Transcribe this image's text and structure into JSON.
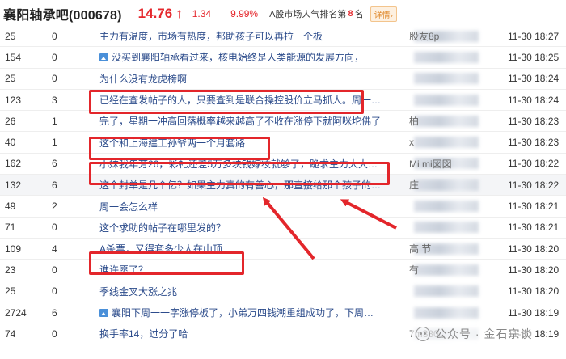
{
  "header": {
    "title": "襄阳轴承吧(000678)",
    "price": "14.76",
    "arrow": "↑",
    "change": "1.34",
    "pct": "9.99%",
    "rank_label": "A股市场人气排名第",
    "rank_num": "8",
    "rank_unit": "名",
    "detail": "详情›"
  },
  "posts": [
    {
      "read": "25",
      "reply": "0",
      "title": "主力有温度，市场有热度，邦助孩子可以再拉一个板",
      "author": "股友8p",
      "time": "11-30 18:27",
      "img": false
    },
    {
      "read": "154",
      "reply": "0",
      "title": "没买到襄阳轴承看过来，核电始终是人类能源的发展方向，",
      "author": "",
      "time": "11-30 18:25",
      "img": true
    },
    {
      "read": "25",
      "reply": "0",
      "title": "为什么没有龙虎榜啊",
      "author": "",
      "time": "11-30 18:24",
      "img": false
    },
    {
      "read": "123",
      "reply": "3",
      "title": "已经在查发帖子的人，只要查到是联合操控股价立马抓人。周一…",
      "author": "",
      "time": "11-30 18:24",
      "img": false
    },
    {
      "read": "26",
      "reply": "1",
      "title": "完了，星期一冲高回落概率越来越高了不收在涨停下就阿咪坨佛了",
      "author": "柏",
      "time": "11-30 18:23",
      "img": false
    },
    {
      "read": "40",
      "reply": "1",
      "title": "这个和上海建工孙爷两一个月套路",
      "author": "x",
      "time": "11-30 18:23",
      "img": false
    },
    {
      "read": "162",
      "reply": "6",
      "title": "小妹我年芳26，彩礼还差5万多块钱嫁妆就够了，跪求主力大大…",
      "author": "Mi mi図図",
      "time": "11-30 18:22",
      "img": false
    },
    {
      "read": "132",
      "reply": "6",
      "title": "这个封单是几个亿？如果主力真的有善心，那直接给那个孩子的…",
      "author": "庄",
      "time": "11-30 18:22",
      "img": false
    },
    {
      "read": "49",
      "reply": "2",
      "title": "周一会怎么样",
      "author": "",
      "time": "11-30 18:21",
      "img": false
    },
    {
      "read": "71",
      "reply": "0",
      "title": "这个求助的帖子在哪里发的？",
      "author": "",
      "time": "11-30 18:21",
      "img": false
    },
    {
      "read": "109",
      "reply": "4",
      "title": "A杀票，又得套多少人在山顶",
      "author": "高 节",
      "time": "11-30 18:20",
      "img": false
    },
    {
      "read": "23",
      "reply": "0",
      "title": "谁许愿了？",
      "author": "有",
      "time": "11-30 18:20",
      "img": false
    },
    {
      "read": "25",
      "reply": "0",
      "title": "季线金叉大涨之兆",
      "author": "",
      "time": "11-30 18:20",
      "img": false
    },
    {
      "read": "2724",
      "reply": "6",
      "title": "襄阳下周一一字涨停板了，小弟万四钱潮重组成功了，下周…",
      "author": "",
      "time": "11-30 18:19",
      "img": true
    },
    {
      "read": "74",
      "reply": "0",
      "title": "换手率14，过分了哈",
      "author": "7m330",
      "time": "11-30 18:19",
      "img": false
    }
  ],
  "watermark": "公众号 · 金石宗谈",
  "colors": {
    "accent_red": "#e5282d",
    "title_blue": "#2a4a8a",
    "highlight": "#e3262b"
  }
}
